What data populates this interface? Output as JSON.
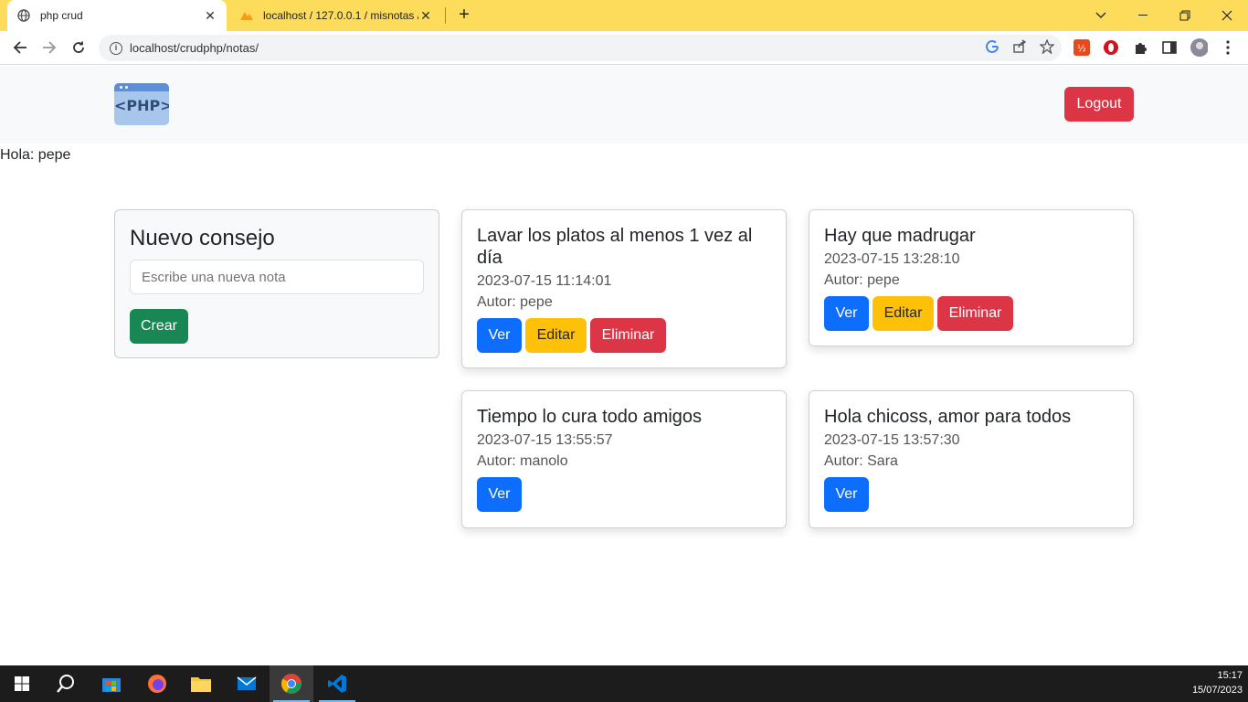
{
  "browser": {
    "tabs": [
      {
        "label": "php crud",
        "active": true
      },
      {
        "label": "localhost / 127.0.0.1 / misnotas /",
        "active": false
      }
    ],
    "url": "localhost/crudphp/notas/",
    "accent": "#fddc5c"
  },
  "navbar": {
    "logo_text": "<PHP>",
    "logout_label": "Logout"
  },
  "greeting": "Hola: pepe",
  "new_note": {
    "title": "Nuevo consejo",
    "placeholder": "Escribe una nueva nota",
    "create_label": "Crear"
  },
  "notes": [
    {
      "title": "Lavar los platos al menos 1 vez al día",
      "date": "2023-07-15 11:14:01",
      "author": "Autor: pepe",
      "view": "Ver",
      "edit": "Editar",
      "delete": "Eliminar"
    },
    {
      "title": "Hay que madrugar",
      "date": "2023-07-15 13:28:10",
      "author": "Autor: pepe",
      "view": "Ver",
      "edit": "Editar",
      "delete": "Eliminar"
    },
    {
      "title": "Tiempo lo cura todo amigos",
      "date": "2023-07-15 13:55:57",
      "author": "Autor: manolo",
      "view": "Ver"
    },
    {
      "title": "Hola chicoss, amor para todos",
      "date": "2023-07-15 13:57:30",
      "author": "Autor: Sara",
      "view": "Ver"
    }
  ],
  "taskbar": {
    "time": "15:17",
    "date": "15/07/2023"
  }
}
